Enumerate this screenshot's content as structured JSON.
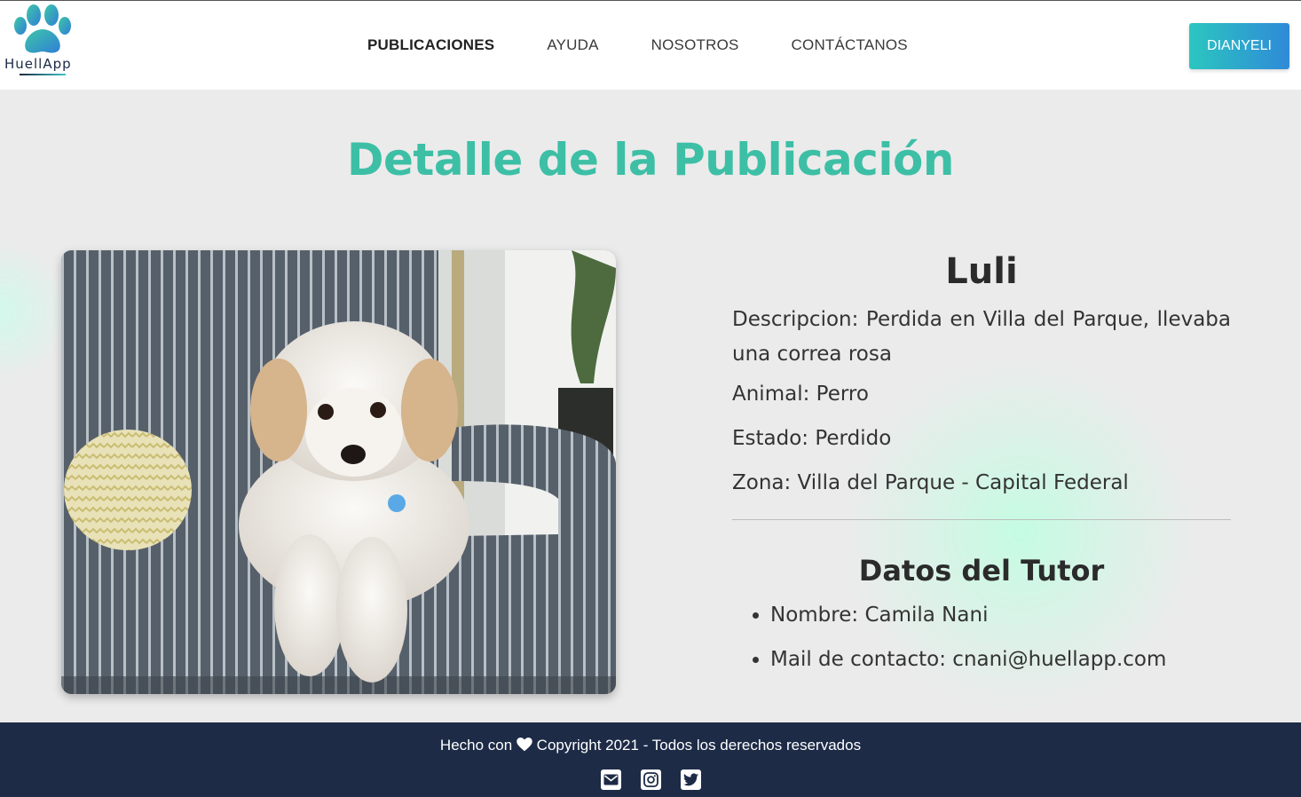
{
  "brand": {
    "name": "HuellApp",
    "colors": {
      "teal": "#3dbfa6",
      "navy": "#1d2b47",
      "gradient_start": "#2bc6c0",
      "gradient_end": "#2f8ad8"
    }
  },
  "nav": {
    "links": [
      {
        "label": "PUBLICACIONES",
        "active": true
      },
      {
        "label": "AYUDA",
        "active": false
      },
      {
        "label": "NOSOTROS",
        "active": false
      },
      {
        "label": "CONTÁCTANOS",
        "active": false
      }
    ],
    "user_button": "DIANYELI"
  },
  "page": {
    "title": "Detalle de la Publicación",
    "photo_icon": "dog-on-sofa-photo"
  },
  "pet": {
    "name": "Luli",
    "description": "Descripcion: Perdida en Villa del Parque, llevaba una correa rosa",
    "animal": "Animal: Perro",
    "status": "Estado: Perdido",
    "zone": "Zona: Villa del Parque - Capital Federal"
  },
  "tutor": {
    "title": "Datos del Tutor",
    "name": "Nombre: Camila Nani",
    "email": "Mail de contacto: cnani@huellapp.com"
  },
  "footer": {
    "made_with": "Hecho con",
    "copyright": "Copyright 2021 - Todos los derechos reservados",
    "icons": [
      "heart-icon",
      "mail-icon",
      "instagram-icon",
      "twitter-icon"
    ]
  }
}
